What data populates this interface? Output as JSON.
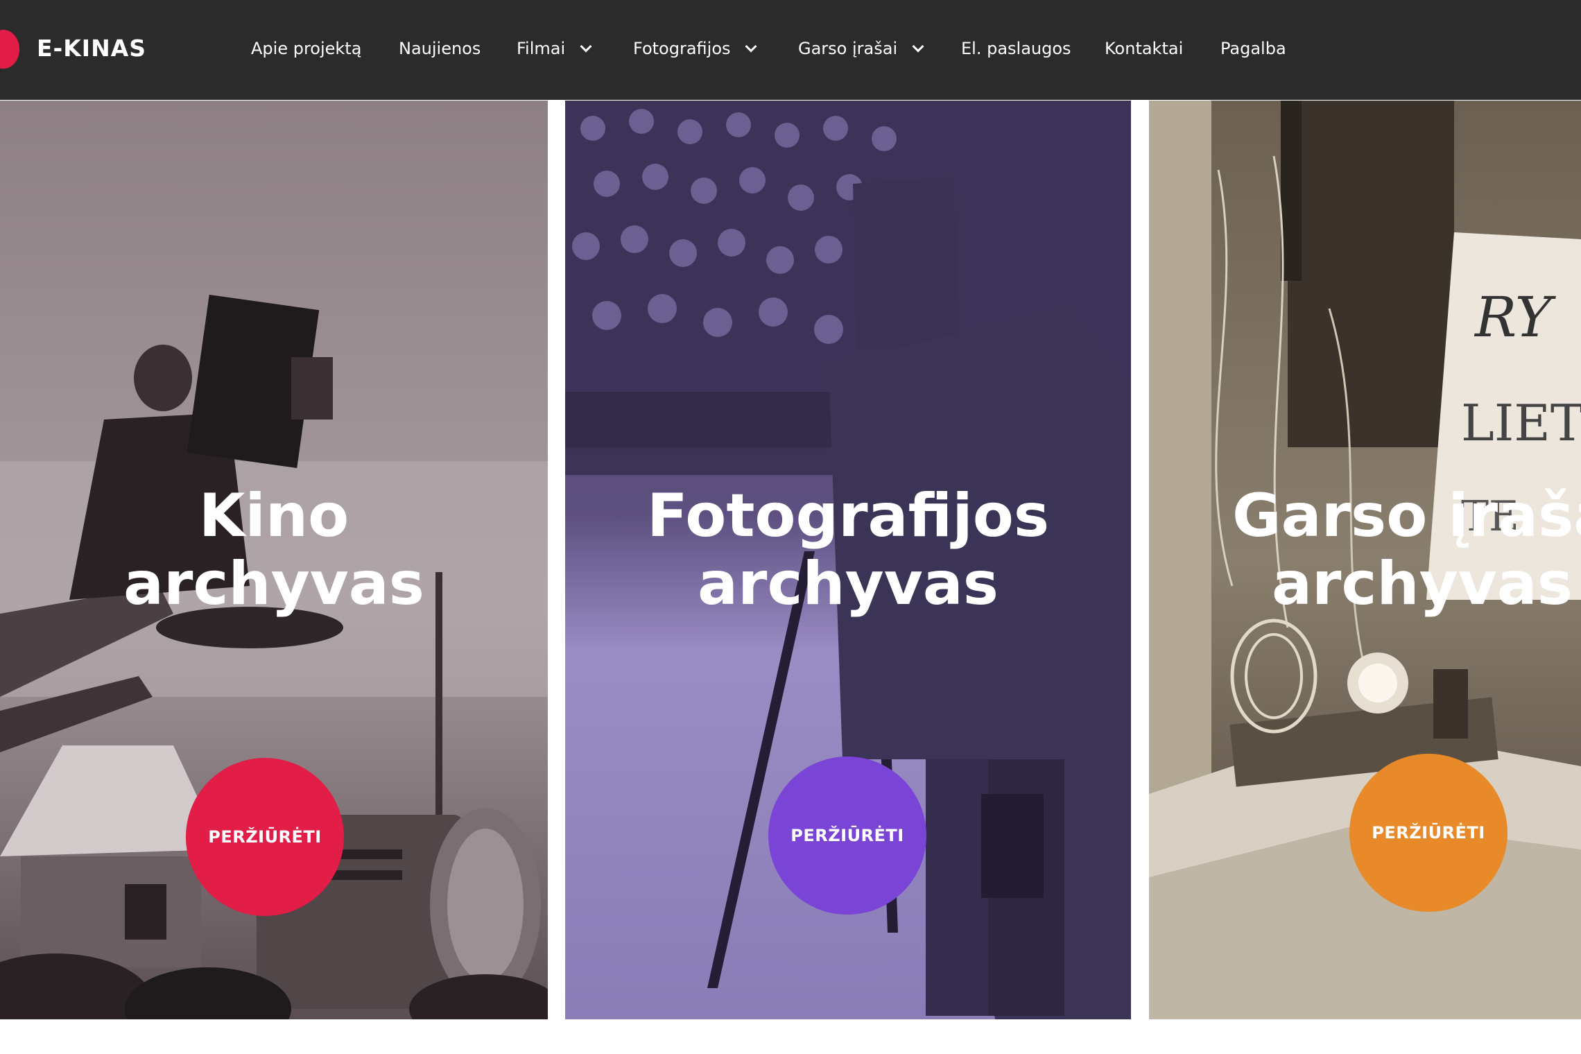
{
  "header": {
    "logo_text": "E-KINAS",
    "logo_color": "#e11d48",
    "background": "#2b2b2b",
    "nav": [
      {
        "label": "Apie projektą",
        "has_dropdown": false
      },
      {
        "label": "Naujienos",
        "has_dropdown": false
      },
      {
        "label": "Filmai",
        "has_dropdown": true
      },
      {
        "label": "Fotografijos",
        "has_dropdown": true
      },
      {
        "label": "Garso įrašai",
        "has_dropdown": true
      },
      {
        "label": "El. paslaugos",
        "has_dropdown": false
      },
      {
        "label": "Kontaktai",
        "has_dropdown": false
      },
      {
        "label": "Pagalba",
        "has_dropdown": false
      }
    ]
  },
  "panels": [
    {
      "title_line1": "Kino",
      "title_line2": "archyvas",
      "button_label": "PERŽIŪRĖTI",
      "button_color": "#e11d48",
      "tint": "#8a7a7e"
    },
    {
      "title_line1": "Fotografijos",
      "title_line2": "archyvas",
      "button_label": "PERŽIŪRĖTI",
      "button_color": "#7a45d6",
      "tint": "#7e6ea6"
    },
    {
      "title_line1": "Garso įrašai",
      "title_line2": "archyvas",
      "button_label": "PERŽIŪRĖTI",
      "button_color": "#e88a2a",
      "tint": "#8c8070"
    }
  ]
}
